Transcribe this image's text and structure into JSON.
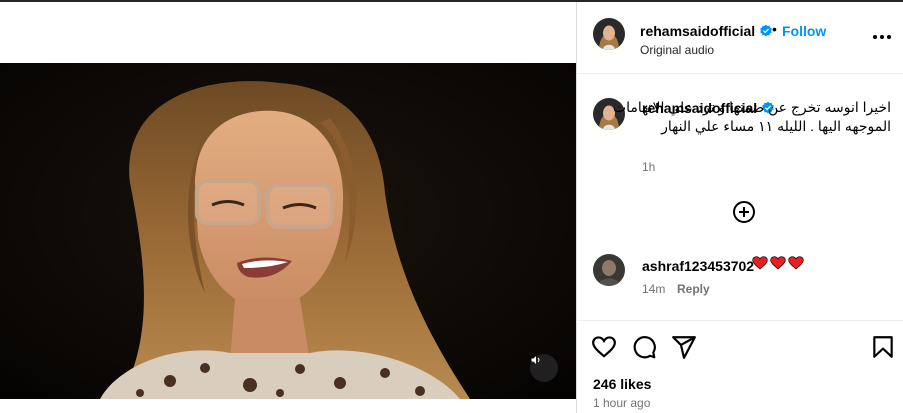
{
  "post": {
    "username": "rehamsaidofficial",
    "follow_separator": "•",
    "follow_label": "Follow",
    "audio_label": "Original audio"
  },
  "caption": {
    "username": "rehamsaidofficial",
    "text": "اخيرا انوسه تخرج عن ضمنها و ترد علي الاتهامات الموجهه اليها . الليله ١١ مساء علي النهار",
    "time": "1h"
  },
  "comments": [
    {
      "username": "ashraf123453702",
      "text": "❤❤❤",
      "time": "14m",
      "reply_label": "Reply"
    }
  ],
  "stats": {
    "likes": "246 likes",
    "posted_ago": "1 hour ago"
  },
  "colors": {
    "accent": "#0095f6",
    "secondary_text": "#737373",
    "heart": "#ed1c24",
    "verified": "#0095f6"
  },
  "icons": [
    "volume-icon",
    "verified-badge-icon",
    "more-options-icon",
    "add-comment-plus-icon",
    "heart-icon",
    "comment-icon",
    "share-icon",
    "bookmark-icon"
  ]
}
